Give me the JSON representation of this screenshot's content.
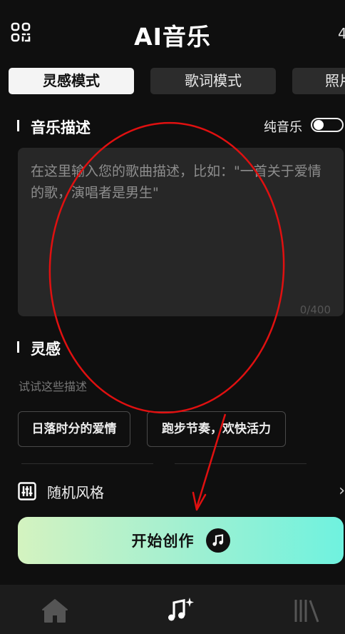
{
  "header": {
    "title": "AI音乐",
    "edge_text": "4"
  },
  "tabs": [
    {
      "label": "灵感模式",
      "active": true
    },
    {
      "label": "歌词模式",
      "active": false
    },
    {
      "label": "照片",
      "active": false
    }
  ],
  "description": {
    "section_title": "音乐描述",
    "pure_music_label": "纯音乐",
    "pure_music_on": false,
    "placeholder": "在这里输入您的歌曲描述，比如：\"一首关于爱情的歌，演唱者是男生\"",
    "value": "",
    "counter": "0/400"
  },
  "inspiration": {
    "section_title": "灵感",
    "subtext": "试试这些描述",
    "chips": [
      "日落时分的爱情",
      "跑步节奏，欢快活力"
    ]
  },
  "random_style": {
    "label": "随机风格",
    "icon": "sliders-icon"
  },
  "create_button": {
    "label": "开始创作",
    "icon": "music-note-icon"
  },
  "bottom_nav": {
    "items": [
      {
        "icon": "home-icon"
      },
      {
        "icon": "music-sparkle-icon"
      },
      {
        "icon": "library-icon"
      }
    ]
  },
  "colors": {
    "background": "#0f0f0f",
    "card": "#272727",
    "tab": "#2c2c2c",
    "accent_gradient_start": "#d4f3c0",
    "accent_gradient_end": "#6ff2df",
    "annotation": "#e01010"
  }
}
